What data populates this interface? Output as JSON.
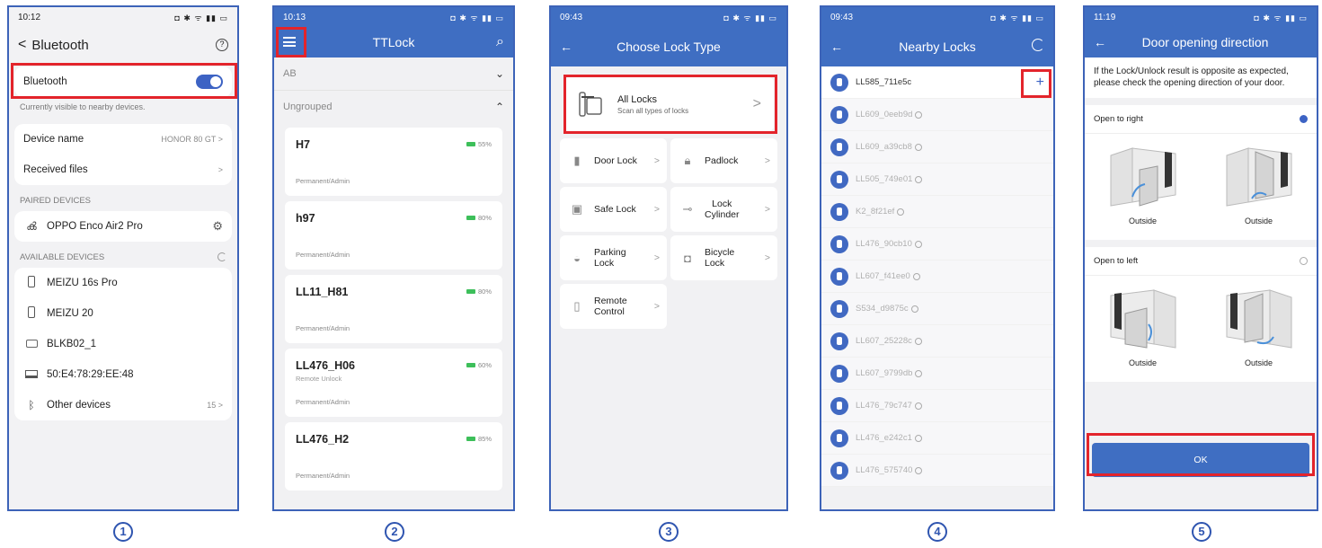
{
  "p1": {
    "time": "10:12",
    "status_icons": "◘ ✱ ᯤ ▮▮ ▭",
    "back": "<",
    "title": "Bluetooth",
    "help": "?",
    "bt_label": "Bluetooth",
    "visible_text": "Currently visible to nearby devices.",
    "device_name_label": "Device name",
    "device_name_value": "HONOR 80 GT >",
    "received_files": "Received files",
    "chev": ">",
    "paired_header": "PAIRED DEVICES",
    "paired": "OPPO Enco Air2 Pro",
    "available_header": "AVAILABLE DEVICES",
    "devices": [
      "MEIZU 16s Pro",
      "MEIZU 20",
      "BLKB02_1",
      "50:E4:78:29:EE:48"
    ],
    "other_devices": "Other devices",
    "other_count": "15 >"
  },
  "p2": {
    "time": "10:13",
    "status_icons": "◘ ✱ ᯤ ▮▮ ▭",
    "title": "TTLock",
    "search": "⌕",
    "group_ab": "AB",
    "group_ungrouped": "Ungrouped",
    "chev_down": "⌄",
    "chev_up": "⌃",
    "locks": [
      {
        "name": "H7",
        "extra": "",
        "role": "Permanent/Admin",
        "battery": "55%"
      },
      {
        "name": "h97",
        "extra": "",
        "role": "Permanent/Admin",
        "battery": "80%"
      },
      {
        "name": "LL11_H81",
        "extra": "",
        "role": "Permanent/Admin",
        "battery": "80%"
      },
      {
        "name": "LL476_H06",
        "extra": "Remote Unlock",
        "role": "Permanent/Admin",
        "battery": "60%"
      },
      {
        "name": "LL476_H2",
        "extra": "",
        "role": "Permanent/Admin",
        "battery": "85%"
      }
    ]
  },
  "p3": {
    "time": "09:43",
    "status_icons": "◘ ✱ ᯤ ▮▮ ▭",
    "back": "←",
    "title": "Choose Lock Type",
    "all_locks": "All Locks",
    "all_locks_sub": "Scan all types of locks",
    "chev": ">",
    "types": [
      "Door Lock",
      "Padlock",
      "Safe Lock",
      "Lock\nCylinder",
      "Parking\nLock",
      "Bicycle\nLock",
      "Remote\nControl"
    ]
  },
  "p4": {
    "time": "09:43",
    "status_icons": "◘ ✱ ᯤ ▮▮ ▭",
    "back": "←",
    "title": "Nearby Locks",
    "plus": "+",
    "locks": [
      "LL585_711e5c",
      "LL609_0eeb9d",
      "LL609_a39cb8",
      "LL505_749e01",
      "K2_8f21ef",
      "LL476_90cb10",
      "LL607_f41ee0",
      "S534_d9875c",
      "LL607_25228c",
      "LL607_9799db",
      "LL476_79c747",
      "LL476_e242c1",
      "LL476_575740"
    ]
  },
  "p5": {
    "time": "11:19",
    "status_icons": "◘ ✱ ᯤ ▮▮ ▭",
    "back": "←",
    "title": "Door opening direction",
    "message": "If the Lock/Unlock result is opposite as expected, please check the opening direction of your door.",
    "open_right": "Open to right",
    "open_left": "Open to left",
    "outside": "Outside",
    "ok": "OK"
  },
  "steps": [
    "1",
    "2",
    "3",
    "4",
    "5"
  ]
}
